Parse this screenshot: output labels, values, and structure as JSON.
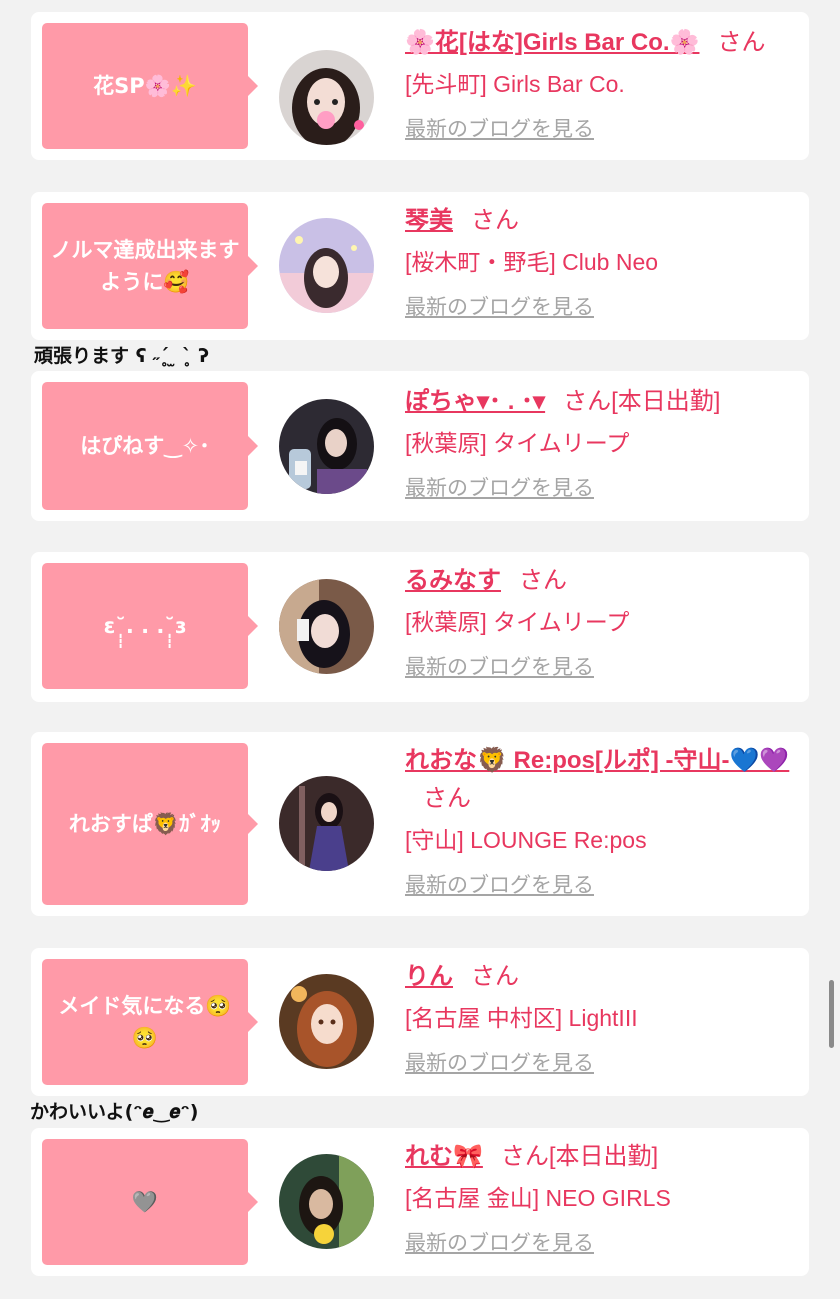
{
  "blog_link_label": "最新のブログを見る",
  "cards": [
    {
      "bubble": "花SP🌸✨",
      "name": "🌸花[はな]Girls Bar Co.🌸",
      "suffix": "さん",
      "shop": "[先斗町] Girls Bar Co."
    },
    {
      "bubble": "ノルマ達成出来ますように🥰",
      "overflow": "頑張ります ʕ ˶ˊ̥ ̫ ˋ̥ ʔ",
      "name": "琴美",
      "suffix": "さん",
      "shop": "[桜木町・野毛] Club Neo"
    },
    {
      "bubble": "はぴねす‿✧･",
      "name": "ぽちゃ▾･ . ･▾",
      "suffix": "さん[本日出勤]",
      "shop": "[秋葉原] タイムリープ"
    },
    {
      "bubble": "ɛ˘̩̩̩. . .˘̩̩̩ɜ",
      "name": "るみなす",
      "suffix": "さん",
      "shop": "[秋葉原] タイムリープ"
    },
    {
      "bubble": "れおすぱ🦁ｶﾞｵｯ",
      "name": "れおな🦁 Re:pos[ルポ] -守山-💙💜",
      "suffix": "さん",
      "shop": "[守山] LOUNGE Re:pos"
    },
    {
      "bubble": "メイド気になる🥺🥺",
      "overflow": "かわいいよ(ᵔ𝒆‿𝒆ᵔ)",
      "name": "りん",
      "suffix": "さん",
      "shop": "[名古屋 中村区] LightIII"
    },
    {
      "bubble": "🩶",
      "name": "れむ🎀",
      "suffix": "さん[本日出勤]",
      "shop": "[名古屋 金山] NEO GIRLS"
    }
  ],
  "colors": {
    "background": "#f2f2f2",
    "card": "#ffffff",
    "bubble": "#ff9aa8",
    "accent": "#e8375f",
    "link_gray": "#a5a5a5"
  }
}
